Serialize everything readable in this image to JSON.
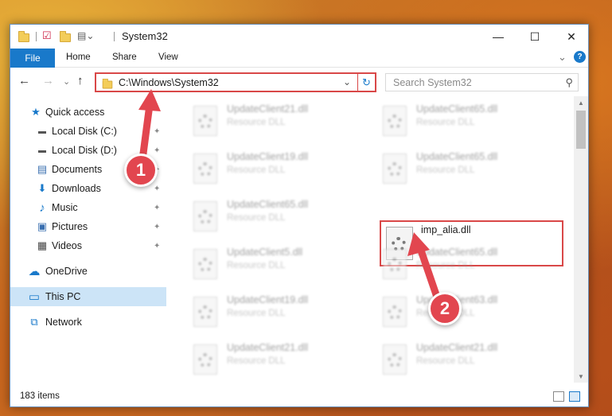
{
  "window": {
    "title": "System32",
    "minimize_glyph": "—",
    "maximize_glyph": "☐",
    "close_glyph": "✕"
  },
  "ribbon": {
    "tabs": [
      "File",
      "Home",
      "Share",
      "View"
    ],
    "expand_glyph": "⌄",
    "help_glyph": "?"
  },
  "address": {
    "path": "C:\\Windows\\System32",
    "search_placeholder": "Search System32",
    "back_glyph": "←",
    "forward_glyph": "→",
    "recent_glyph": "⌄",
    "up_glyph": "↑",
    "dropdown_glyph": "⌄",
    "refresh_glyph": "↻",
    "search_glyph": "⚲"
  },
  "sidebar": {
    "items": [
      {
        "label": "Quick access",
        "icon": "star-icon",
        "glyph": "★",
        "color": "#1979ca"
      },
      {
        "label": "Local Disk (C:)",
        "icon": "drive-icon",
        "glyph": "▬",
        "color": "#555555",
        "pinned": true
      },
      {
        "label": "Local Disk (D:)",
        "icon": "drive-icon",
        "glyph": "▬",
        "color": "#555555",
        "pinned": true
      },
      {
        "label": "Documents",
        "icon": "documents-icon",
        "glyph": "▤",
        "color": "#3a6fb0",
        "pinned": true
      },
      {
        "label": "Downloads",
        "icon": "downloads-icon",
        "glyph": "⬇",
        "color": "#1979ca",
        "pinned": true
      },
      {
        "label": "Music",
        "icon": "music-icon",
        "glyph": "♪",
        "color": "#1979ca",
        "pinned": true
      },
      {
        "label": "Pictures",
        "icon": "pictures-icon",
        "glyph": "▣",
        "color": "#3a6fb0",
        "pinned": true
      },
      {
        "label": "Videos",
        "icon": "videos-icon",
        "glyph": "▦",
        "color": "#444444",
        "pinned": true
      },
      {
        "label": "OneDrive",
        "icon": "cloud-icon",
        "glyph": "☁",
        "color": "#1979ca"
      },
      {
        "label": "This PC",
        "icon": "pc-icon",
        "glyph": "▭",
        "color": "#1979ca",
        "selected": true
      },
      {
        "label": "Network",
        "icon": "network-icon",
        "glyph": "⧉",
        "color": "#1979ca"
      }
    ],
    "pin_glyph": "📌"
  },
  "files": [
    {
      "name": "UpdateClient21.dll",
      "desc": "Resource DLL"
    },
    {
      "name": "UpdateClient65.dll",
      "desc": "Resource DLL"
    },
    {
      "name": "UpdateClient19.dll",
      "desc": "Resource DLL"
    },
    {
      "name": "UpdateClient65.dll",
      "desc": "Resource DLL"
    },
    {
      "name": "UpdateClient65.dll",
      "desc": "Resource DLL"
    },
    {
      "name": "imp_alia.dll",
      "desc": ""
    },
    {
      "name": "UpdateClient5.dll",
      "desc": "Resource DLL"
    },
    {
      "name": "UpdateClient65.dll",
      "desc": "Resource DLL"
    },
    {
      "name": "UpdateClient19.dll",
      "desc": "Resource DLL"
    },
    {
      "name": "UpdateClient63.dll",
      "desc": "Resource DLL"
    },
    {
      "name": "UpdateClient21.dll",
      "desc": "Resource DLL"
    },
    {
      "name": "UpdateClient21.dll",
      "desc": "Resource DLL"
    }
  ],
  "highlighted_file": "imp_alia.dll",
  "status": {
    "items_count": "183 items"
  },
  "annotations": {
    "step1": "1",
    "step2": "2"
  },
  "colors": {
    "accent": "#1979ca",
    "annotation_red": "#d94848"
  }
}
